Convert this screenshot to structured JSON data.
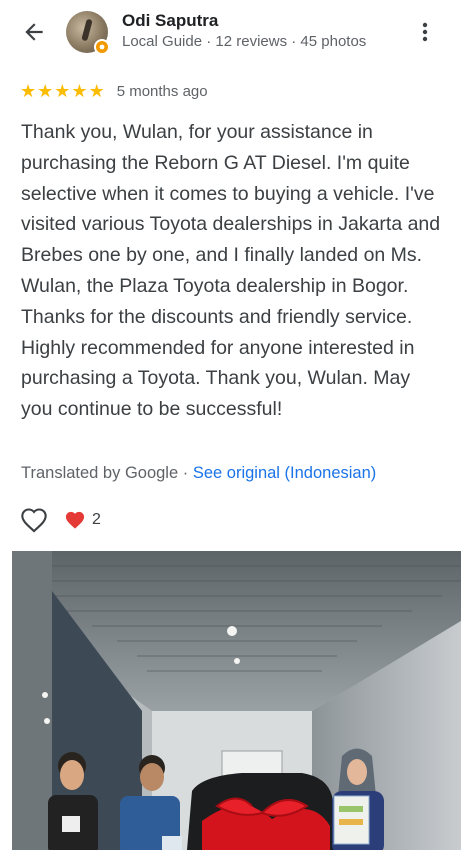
{
  "author": {
    "name": "Odi Saputra",
    "meta": "Local Guide · 12 reviews · 45 photos"
  },
  "review": {
    "rating": 5,
    "stars": [
      "★",
      "★",
      "★",
      "★",
      "★"
    ],
    "time_ago": "5 months ago",
    "text": "Thank you, Wulan, for your assistance in purchasing the Reborn G AT Diesel. I'm quite selective when it comes to buying a vehicle. I've visited various Toyota dealerships in Jakarta and Brebes one by one, and I finally landed on Ms. Wulan, the Plaza Toyota dealership in Bogor. Thanks for the discounts and friendly service. Highly recommended for anyone interested in purchasing a Toyota. Thank you, Wulan. May you continue to be successful!",
    "translated_label": "Translated by Google",
    "separator": " · ",
    "see_original": "See original (Indonesian)",
    "reaction_count": "2"
  },
  "icons": {
    "back": "arrow-back-icon",
    "more": "more-vert-icon",
    "like": "heart-outline-icon",
    "reaction": "heart-filled-icon",
    "badge": "local-guide-badge-icon"
  },
  "colors": {
    "star": "#fbbc04",
    "link": "#1a73e8",
    "reaction_heart": "#e53935",
    "guide_badge": "#f29900"
  }
}
